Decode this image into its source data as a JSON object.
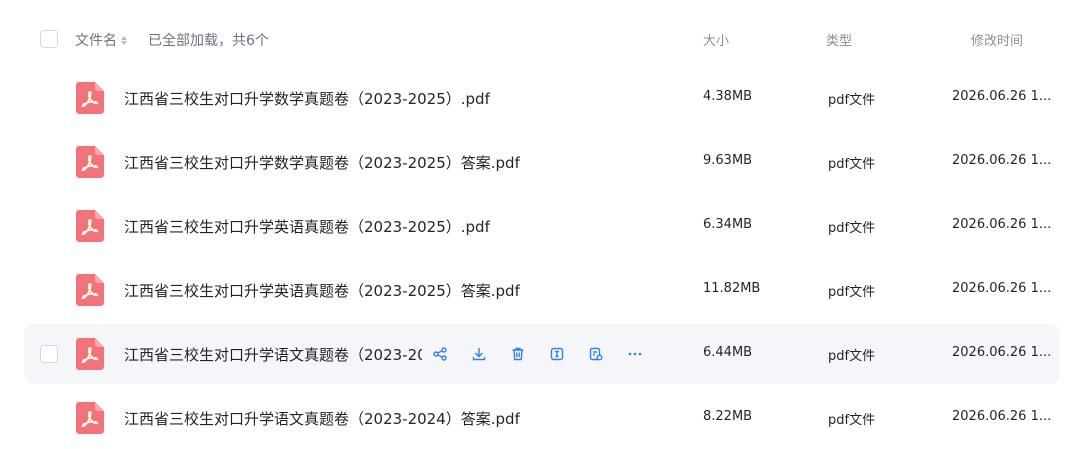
{
  "header": {
    "name_label": "文件名",
    "loaded_text": "已全部加载，共6个",
    "size_label": "大小",
    "type_label": "类型",
    "time_label": "修改时间"
  },
  "colors": {
    "pdf_icon": "#f3737a",
    "action_icon": "#2f80ed",
    "hover_row": "#f5f6f9"
  },
  "files": [
    {
      "name": "江西省三校生对口升学数学真题卷（2023-2025）.pdf",
      "size": "4.38MB",
      "type": "pdf文件",
      "time": "2026.06.26 1..."
    },
    {
      "name": "江西省三校生对口升学数学真题卷（2023-2025）答案.pdf",
      "size": "9.63MB",
      "type": "pdf文件",
      "time": "2026.06.26 1..."
    },
    {
      "name": "江西省三校生对口升学英语真题卷（2023-2025）.pdf",
      "size": "6.34MB",
      "type": "pdf文件",
      "time": "2026.06.26 1..."
    },
    {
      "name": "江西省三校生对口升学英语真题卷（2023-2025）答案.pdf",
      "size": "11.82MB",
      "type": "pdf文件",
      "time": "2026.06.26 1..."
    },
    {
      "name": "江西省三校生对口升学语文真题卷（2023-20",
      "size": "6.44MB",
      "type": "pdf文件",
      "time": "2026.06.26 1..."
    },
    {
      "name": "江西省三校生对口升学语文真题卷（2023-2024）答案.pdf",
      "size": "8.22MB",
      "type": "pdf文件",
      "time": "2026.06.26 1..."
    }
  ],
  "hover_actions": [
    "share-icon",
    "download-icon",
    "delete-icon",
    "rename-icon",
    "save-icon",
    "more-icon"
  ]
}
